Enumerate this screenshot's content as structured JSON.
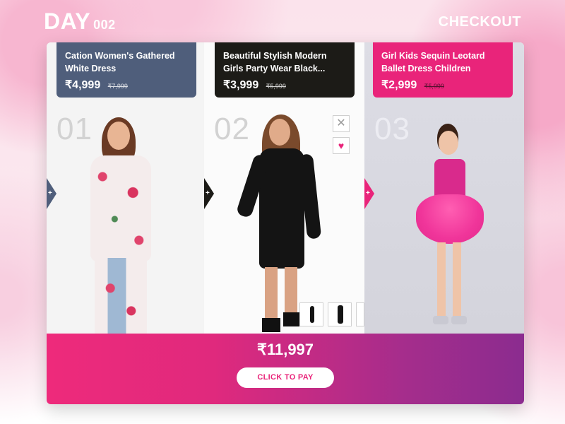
{
  "header": {
    "day_label": "DAY",
    "day_number": "002",
    "checkout_label": "CHECKOUT"
  },
  "products": [
    {
      "title": "Cation Women's Gathered White Dress",
      "price": "₹4,999",
      "old_price": "₹7,999",
      "index": "01",
      "tab_glyph": "+",
      "color": "#4f5e7b"
    },
    {
      "title": "Beautiful Stylish Modern Girls Party Wear Black...",
      "price": "₹3,999",
      "old_price": "₹5,999",
      "index": "02",
      "tab_glyph": "+",
      "color": "#1c1b17"
    },
    {
      "title": "Girl Kids Sequin Leotard Ballet Dress Children Stage...",
      "price": "₹2,999",
      "old_price": "₹5,999",
      "index": "03",
      "tab_glyph": "+",
      "color": "#e9247a"
    }
  ],
  "actions": {
    "close_glyph": "✕",
    "favorite_glyph": "♥"
  },
  "footer": {
    "total": "₹11,997",
    "pay_label": "CLICK TO PAY"
  },
  "colors": {
    "accent": "#e9247a",
    "gradient_end": "#8b2c8f"
  }
}
